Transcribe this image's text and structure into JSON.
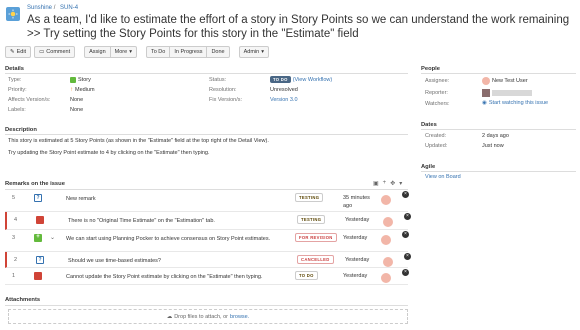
{
  "breadcrumb": {
    "project": "Sunshine",
    "separator": "/",
    "issue_key": "SUN-4"
  },
  "issue": {
    "title": "As a team, I'd like to estimate the effort of a story in Story Points so we can understand the work remaining >> Try setting the Story Points for this story in the \"Estimate\" field"
  },
  "toolbar": {
    "edit": "Edit",
    "comment": "Comment",
    "assign": "Assign",
    "more": "More",
    "todo": "To Do",
    "in_progress": "In Progress",
    "done": "Done",
    "admin": "Admin"
  },
  "details": {
    "heading": "Details",
    "type_label": "Type:",
    "type_value": "Story",
    "priority_label": "Priority:",
    "priority_value": "Medium",
    "affects_label": "Affects Version/s:",
    "affects_value": "None",
    "labels_label": "Labels:",
    "labels_value": "None",
    "status_label": "Status:",
    "status_value": "TO DO",
    "status_link": "(View Workflow)",
    "resolution_label": "Resolution:",
    "resolution_value": "Unresolved",
    "fix_label": "Fix Version/s:",
    "fix_value": "Version 3.0"
  },
  "description": {
    "heading": "Description",
    "line1": "This story is estimated at 5 Story Points (as shown in the \"Estimate\" field at the top right of the Detail View).",
    "line2": "Try updating the Story Point estimate to 4 by clicking on the \"Estimate\" then typing."
  },
  "remarks": {
    "heading": "Remarks on the issue",
    "rows": [
      {
        "id": "5",
        "summary": "New remark",
        "status": "TESTING",
        "updated": "35 minutes ago"
      },
      {
        "id": "4",
        "summary": "There is no \"Original Time Estimate\" on the \"Estimation\" tab.",
        "status": "TESTING",
        "updated": "Yesterday"
      },
      {
        "id": "3",
        "summary": "We can start using Planning Pocker to achieve consensus on Story Point estimates.",
        "status": "FOR REVISION",
        "updated": "Yesterday"
      },
      {
        "id": "2",
        "summary": "Should we use time-based estimates?",
        "status": "CANCELLED",
        "updated": "Yesterday"
      },
      {
        "id": "1",
        "summary": "Cannot update the Story Point estimate by clicking on the \"Estimate\" then typing.",
        "status": "TO DO",
        "updated": "Yesterday"
      }
    ]
  },
  "attachments": {
    "heading": "Attachments",
    "drop_text": "Drop files to attach, or",
    "browse": "browse."
  },
  "people": {
    "heading": "People",
    "assignee_label": "Assignee:",
    "assignee_value": "New Test User",
    "reporter_label": "Reporter:",
    "watchers_label": "Watchers:",
    "watchers_value": "Start watching this issue"
  },
  "dates": {
    "heading": "Dates",
    "created_label": "Created:",
    "created_value": "2 days ago",
    "updated_label": "Updated:",
    "updated_value": "Just now"
  },
  "agile": {
    "heading": "Agile",
    "link": "View on Board"
  },
  "colors": {
    "link": "#3572b0",
    "todo": "#4a6785",
    "red": "#d04437",
    "green": "#63ba3c"
  }
}
